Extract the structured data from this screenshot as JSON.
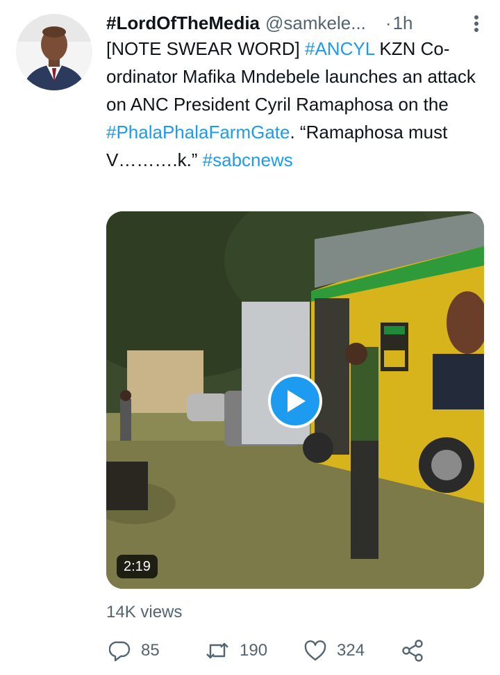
{
  "tweet": {
    "author_name": "#LordOfTheMedia",
    "author_handle": "@samkele...",
    "separator": "·",
    "time": "1h",
    "body": {
      "part1": "[NOTE SWEAR WORD] ",
      "tag1": "#ANCYL",
      "part2": " KZN Co-ordinator Mafika Mndebele launches an attack on ANC President Cyril Ramaphosa on the ",
      "tag2": "#PhalaPhalaFarmGate",
      "part3": ". “Ramaphosa must V……….k.” ",
      "tag3": "#sabcnews"
    },
    "video_duration": "2:19",
    "views": "14K views",
    "reply_count": "85",
    "retweet_count": "190",
    "like_count": "324"
  },
  "colors": {
    "accent": "#1d9bf0",
    "secondary_text": "#536471",
    "primary_text": "#0f1419"
  },
  "icons": [
    "more-icon",
    "play-icon",
    "reply-icon",
    "retweet-icon",
    "like-icon",
    "share-icon"
  ]
}
